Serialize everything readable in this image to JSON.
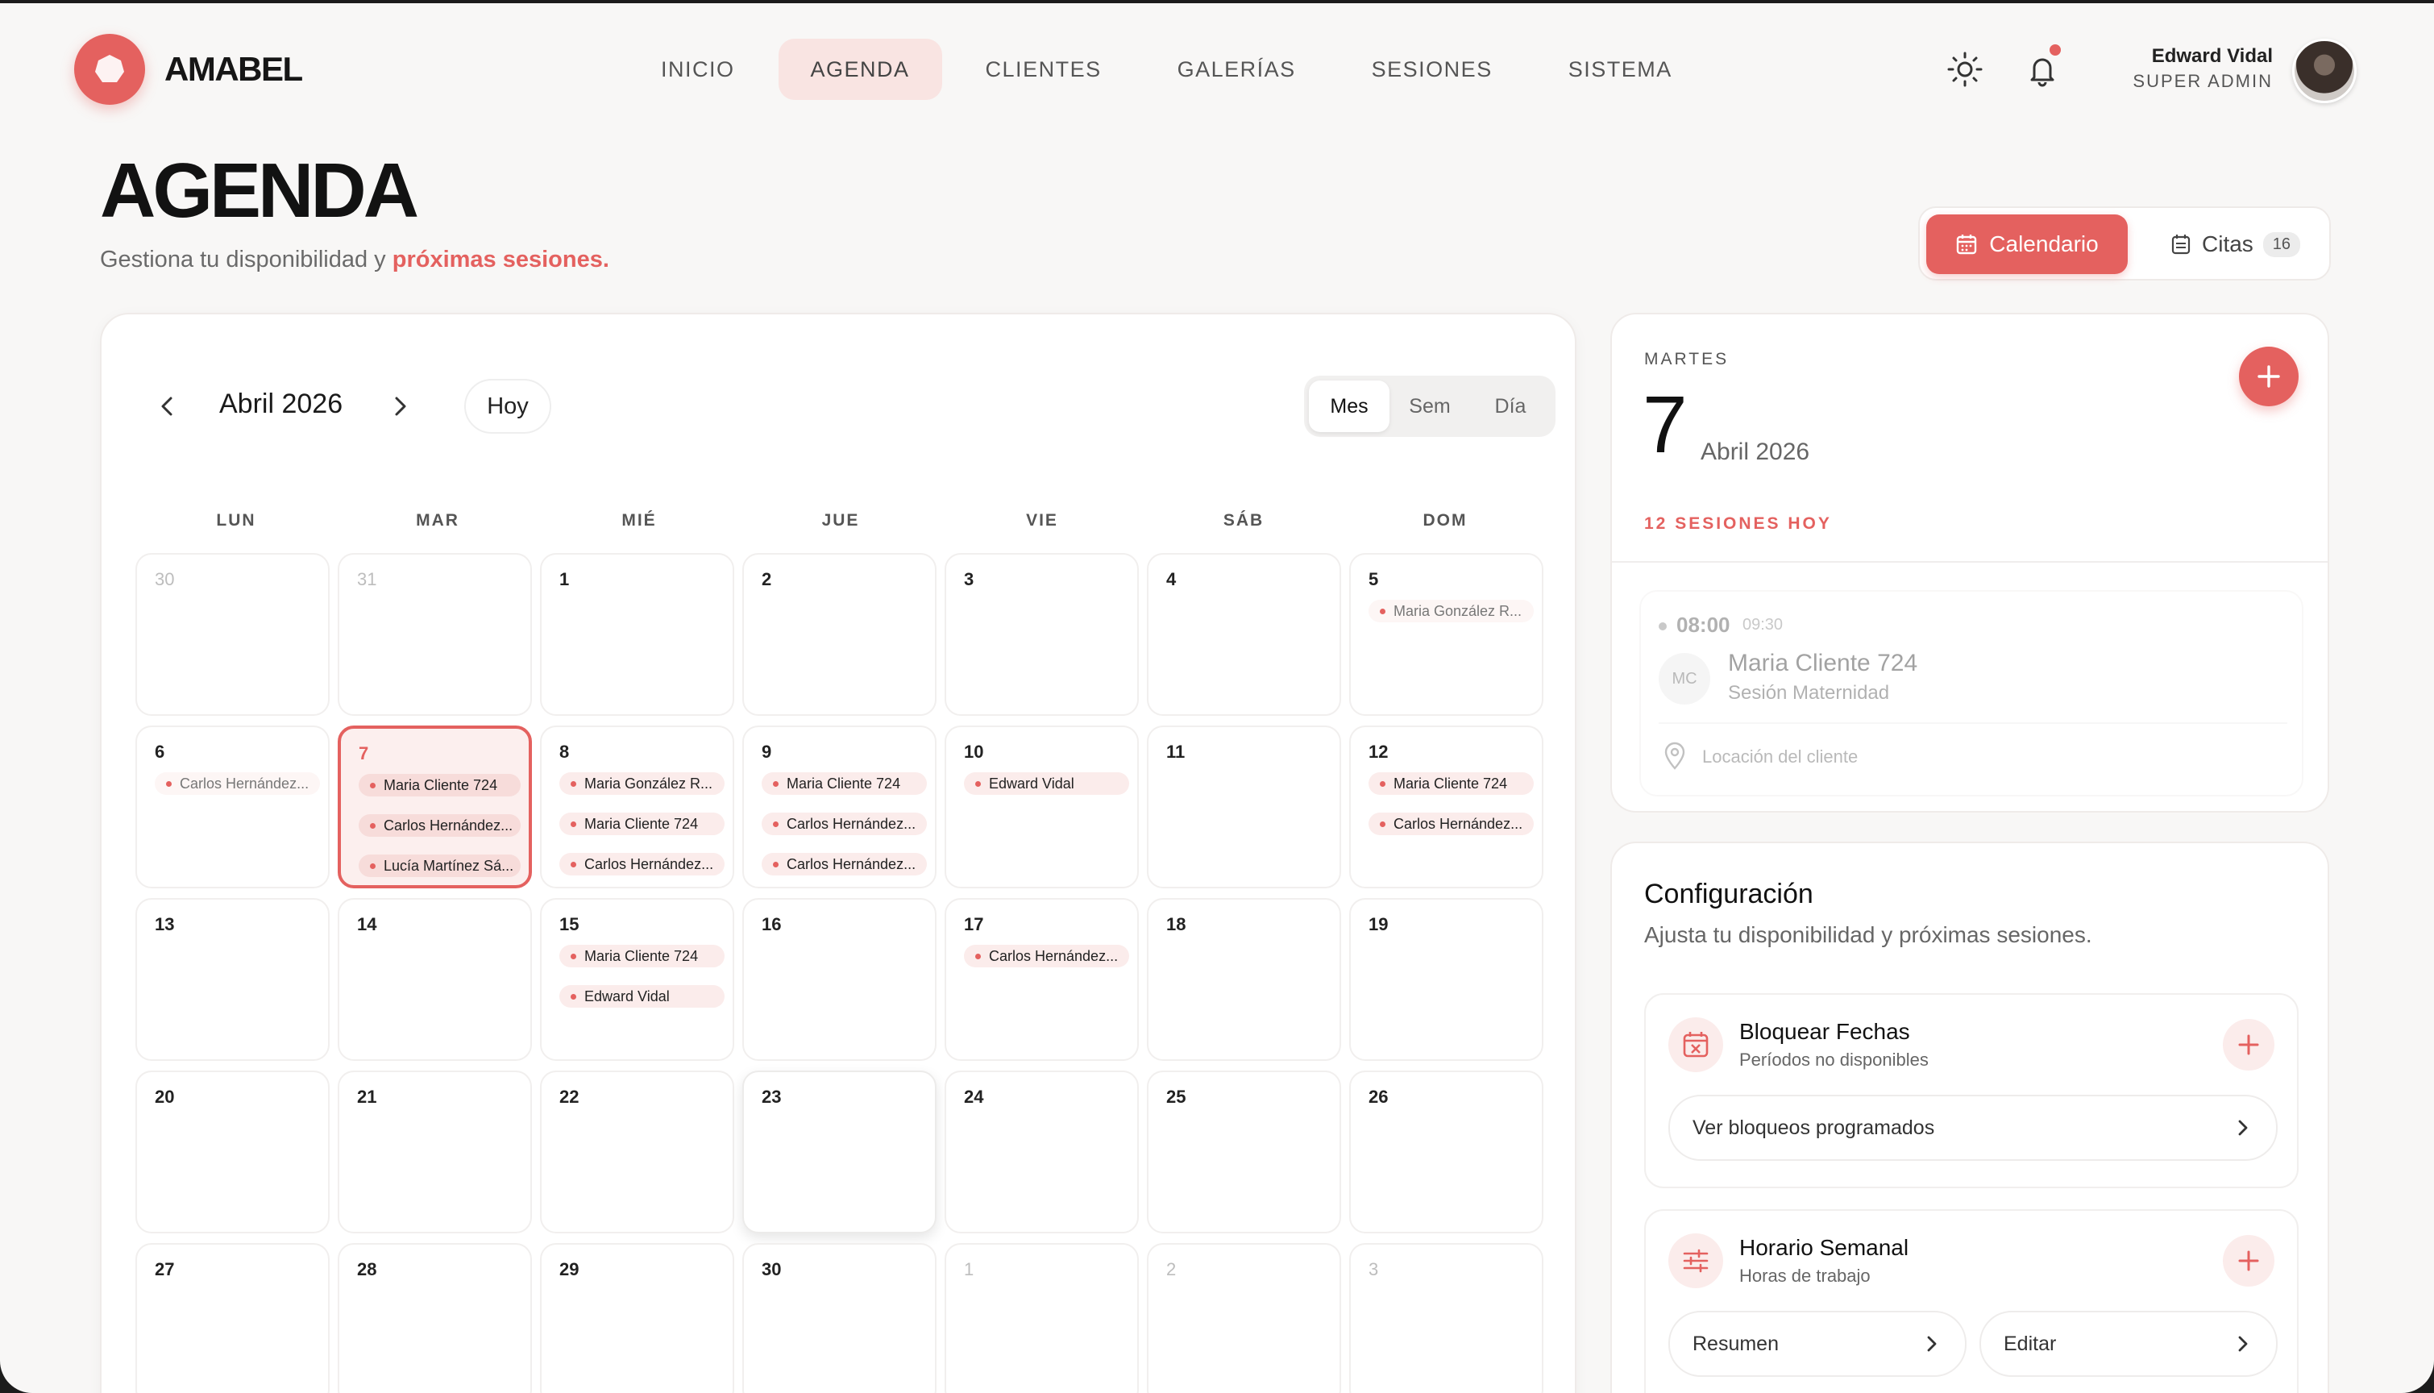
{
  "brand": {
    "name": "AMABEL",
    "accent": "#e4615f"
  },
  "nav": {
    "items": [
      {
        "label": "INICIO"
      },
      {
        "label": "AGENDA",
        "active": true
      },
      {
        "label": "CLIENTES"
      },
      {
        "label": "GALERÍAS"
      },
      {
        "label": "SESIONES"
      },
      {
        "label": "SISTEMA"
      }
    ]
  },
  "header_icons": [
    "sun-icon",
    "bell-icon"
  ],
  "user": {
    "name": "Edward Vidal",
    "role": "SUPER ADMIN"
  },
  "page": {
    "title": "AGENDA",
    "subtitle_prefix": "Gestiona tu disponibilidad y ",
    "subtitle_accent": "próximas sesiones."
  },
  "view_toggle": {
    "calendar_label": "Calendario",
    "citas_label": "Citas",
    "citas_count": "16"
  },
  "calendar": {
    "month_label": "Abril 2026",
    "today_label": "Hoy",
    "ranges": [
      {
        "label": "Mes",
        "active": true
      },
      {
        "label": "Sem"
      },
      {
        "label": "Día"
      }
    ],
    "weekdays": [
      "LUN",
      "MAR",
      "MIÉ",
      "JUE",
      "VIE",
      "SÁB",
      "DOM"
    ],
    "weeks": [
      [
        {
          "day": "30",
          "muted": true,
          "events": []
        },
        {
          "day": "31",
          "muted": true,
          "events": []
        },
        {
          "day": "1",
          "events": []
        },
        {
          "day": "2",
          "events": []
        },
        {
          "day": "3",
          "events": []
        },
        {
          "day": "4",
          "events": []
        },
        {
          "day": "5",
          "events": [
            {
              "label": "Maria González R...",
              "soft": true
            }
          ]
        }
      ],
      [
        {
          "day": "6",
          "events": [
            {
              "label": "Carlos Hernández...",
              "soft": true
            }
          ]
        },
        {
          "day": "7",
          "selected": true,
          "events": [
            {
              "label": "Maria Cliente 724"
            },
            {
              "label": "Carlos Hernández..."
            },
            {
              "label": "Lucía Martínez Sá..."
            }
          ]
        },
        {
          "day": "8",
          "events": [
            {
              "label": "Maria González R..."
            },
            {
              "label": "Maria Cliente 724"
            },
            {
              "label": "Carlos Hernández..."
            }
          ]
        },
        {
          "day": "9",
          "events": [
            {
              "label": "Maria Cliente 724"
            },
            {
              "label": "Carlos Hernández..."
            },
            {
              "label": "Carlos Hernández..."
            }
          ]
        },
        {
          "day": "10",
          "events": [
            {
              "label": "Edward Vidal"
            }
          ]
        },
        {
          "day": "11",
          "events": []
        },
        {
          "day": "12",
          "events": [
            {
              "label": "Maria Cliente 724"
            },
            {
              "label": "Carlos Hernández..."
            }
          ]
        }
      ],
      [
        {
          "day": "13",
          "events": []
        },
        {
          "day": "14",
          "events": []
        },
        {
          "day": "15",
          "events": [
            {
              "label": "Maria Cliente 724"
            },
            {
              "label": "Edward Vidal"
            }
          ]
        },
        {
          "day": "16",
          "events": []
        },
        {
          "day": "17",
          "events": [
            {
              "label": "Carlos Hernández..."
            }
          ]
        },
        {
          "day": "18",
          "events": []
        },
        {
          "day": "19",
          "events": []
        }
      ],
      [
        {
          "day": "20",
          "events": []
        },
        {
          "day": "21",
          "events": []
        },
        {
          "day": "22",
          "events": []
        },
        {
          "day": "23",
          "hover": true,
          "events": []
        },
        {
          "day": "24",
          "events": []
        },
        {
          "day": "25",
          "events": []
        },
        {
          "day": "26",
          "events": []
        }
      ],
      [
        {
          "day": "27",
          "events": []
        },
        {
          "day": "28",
          "events": []
        },
        {
          "day": "29",
          "events": []
        },
        {
          "day": "30",
          "events": []
        },
        {
          "day": "1",
          "muted": true,
          "events": []
        },
        {
          "day": "2",
          "muted": true,
          "events": []
        },
        {
          "day": "3",
          "muted": true,
          "events": []
        }
      ]
    ]
  },
  "day_panel": {
    "weekday": "MARTES",
    "day": "7",
    "month_year": "Abril 2026",
    "sessions_count": "12 SESIONES HOY",
    "session": {
      "start": "08:00",
      "end": "09:30",
      "initials": "MC",
      "client": "Maria Cliente 724",
      "type": "Sesión Maternidad",
      "location": "Locación del cliente"
    }
  },
  "config": {
    "title": "Configuración",
    "subtitle": "Ajusta tu disponibilidad y próximas sesiones.",
    "block_dates": {
      "title": "Bloquear Fechas",
      "subtitle": "Períodos no disponibles",
      "link": "Ver bloqueos programados"
    },
    "weekly": {
      "title": "Horario Semanal",
      "subtitle": "Horas de trabajo",
      "summary": "Resumen",
      "edit": "Editar"
    }
  }
}
